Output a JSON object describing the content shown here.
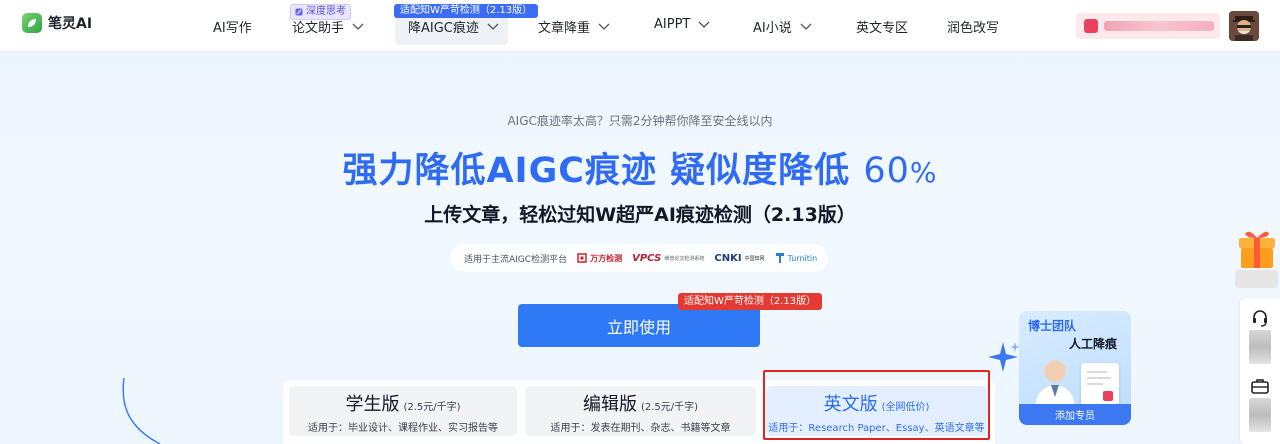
{
  "app": {
    "name": "笔灵AI"
  },
  "nav": {
    "items": [
      {
        "label": "AI写作",
        "dropdown": false
      },
      {
        "label": "论文助手",
        "dropdown": true,
        "badge": "深度思考"
      },
      {
        "label": "降AIGC痕迹",
        "dropdown": true,
        "badge": "适配知W严苛检测（2.13版）",
        "active": true
      },
      {
        "label": "文章降重",
        "dropdown": true
      },
      {
        "label": "AIPPT",
        "dropdown": true
      },
      {
        "label": "AI小说",
        "dropdown": true
      },
      {
        "label": "英文专区",
        "dropdown": false
      },
      {
        "label": "润色改写",
        "dropdown": false
      }
    ]
  },
  "hero": {
    "subtitle": "AIGC痕迹率太高？只需2分钟帮你降至安全线以内",
    "title_main": "强力降低AIGC痕迹 疑似度降低",
    "title_number": "60",
    "title_unit": "%",
    "description": "上传文章，轻松过知W超严AI痕迹检测（2.13版）",
    "platforms_label": "适用于主流AIGC检测平台",
    "platforms": [
      "万方检测",
      "VPCS",
      "CNKI",
      "Turnitin"
    ],
    "platform_captions": [
      "",
      "维普论文检测系统",
      "中国知网",
      ""
    ],
    "cta_label": "立即使用",
    "cta_tag": "适配知W严苛检测（2.13版）"
  },
  "plans": [
    {
      "name": "学生版",
      "price": "(2.5元/千字)",
      "use": "适用于：毕业设计、课程作业、实习报告等"
    },
    {
      "name": "编辑版",
      "price": "(2.5元/千字)",
      "use": "适用于：发表在期刊、杂志、书籍等文章"
    },
    {
      "name": "英文版",
      "price": "(全网低价)",
      "use": "适用于：Research Paper、Essay、英语文章等",
      "selected": true
    }
  ],
  "promo": {
    "tag": "博士团队",
    "title": "人工降痕",
    "button": "添加专员"
  },
  "colors": {
    "primary": "#2f79f6",
    "title_blue": "#2f6bf3",
    "tag_red": "#e43a34",
    "highlight_border": "#e02424"
  }
}
